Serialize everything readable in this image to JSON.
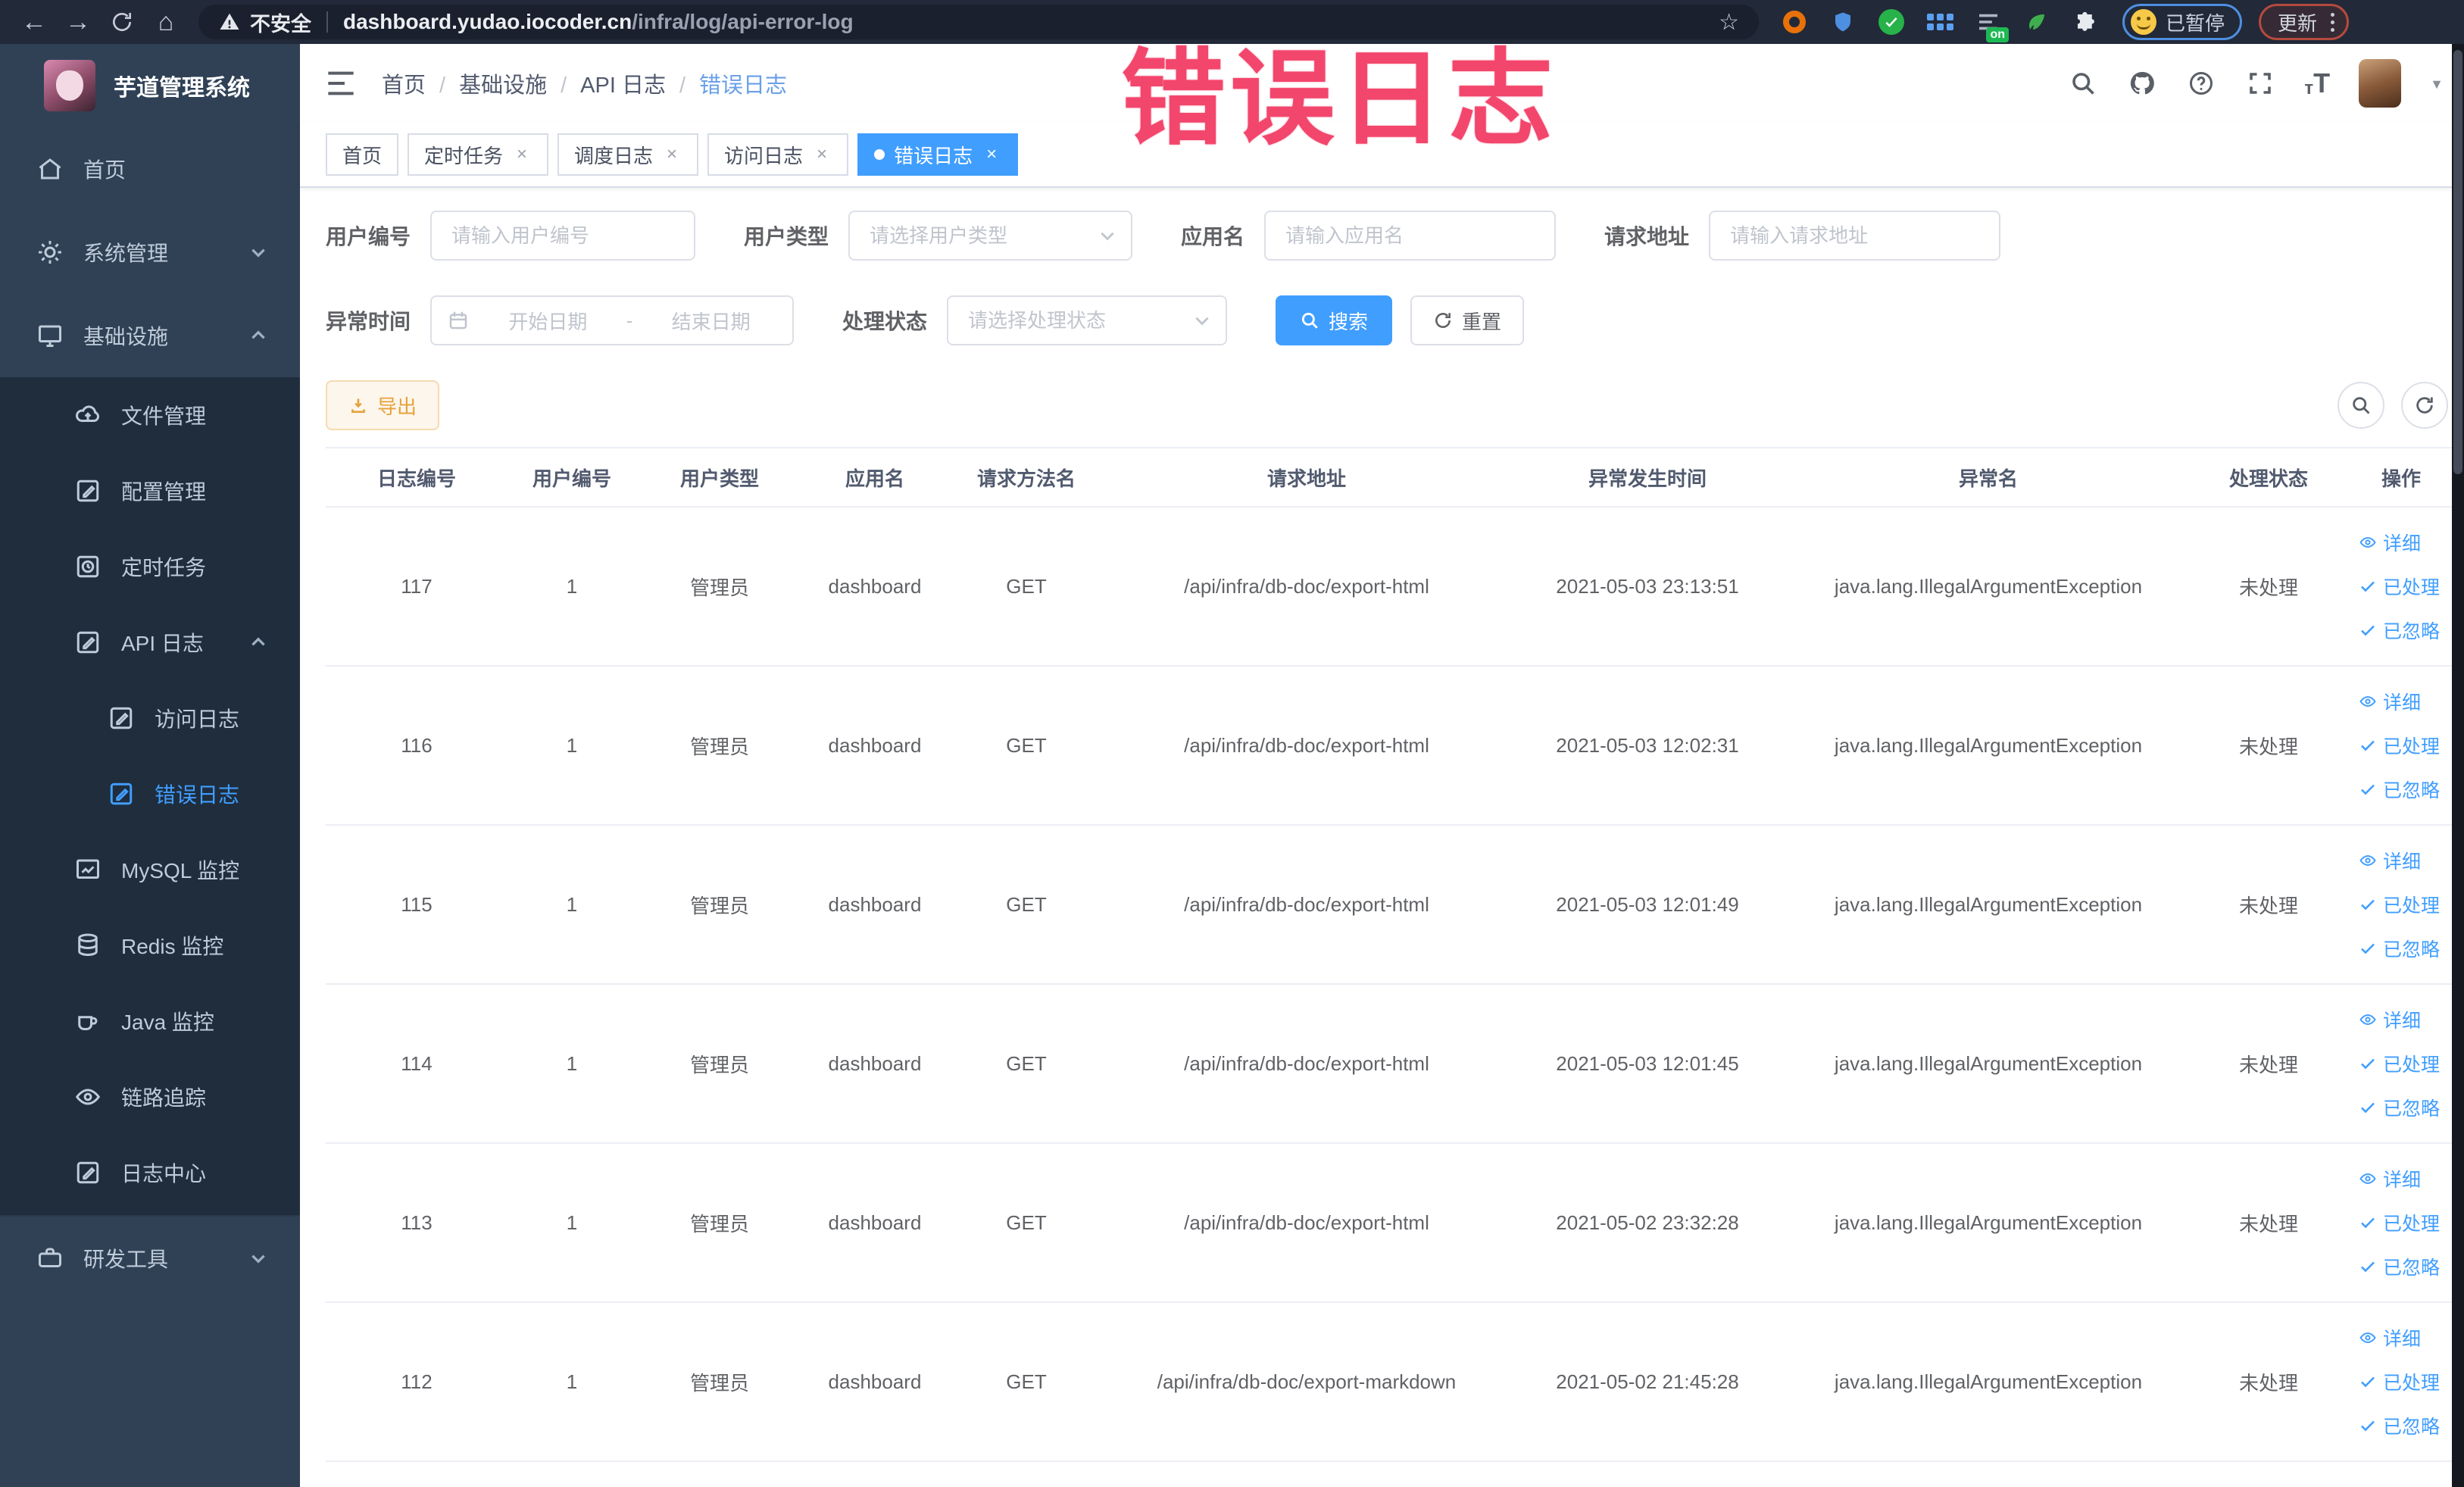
{
  "browser": {
    "security_label": "不安全",
    "url_host": "dashboard.yudao.iocoder.cn",
    "url_path": "/infra/log/api-error-log",
    "paused_badge": "已暂停",
    "update_label": "更新",
    "extension_badge": "on"
  },
  "sidebar": {
    "title": "芋道管理系统",
    "items": [
      {
        "label": "首页",
        "icon": "home-icon"
      },
      {
        "label": "系统管理",
        "icon": "gear-icon"
      },
      {
        "label": "基础设施",
        "icon": "monitor-icon"
      },
      {
        "label": "文件管理",
        "icon": "cloud-upload-icon"
      },
      {
        "label": "配置管理",
        "icon": "edit-icon"
      },
      {
        "label": "定时任务",
        "icon": "timer-icon"
      },
      {
        "label": "API 日志",
        "icon": "log-icon"
      },
      {
        "label": "访问日志",
        "icon": "log-icon"
      },
      {
        "label": "错误日志",
        "icon": "log-icon"
      },
      {
        "label": "MySQL 监控",
        "icon": "chart-icon"
      },
      {
        "label": "Redis 监控",
        "icon": "database-icon"
      },
      {
        "label": "Java 监控",
        "icon": "coffee-icon"
      },
      {
        "label": "链路追踪",
        "icon": "eye-icon"
      },
      {
        "label": "日志中心",
        "icon": "log-icon"
      },
      {
        "label": "研发工具",
        "icon": "toolbox-icon"
      }
    ]
  },
  "header": {
    "breadcrumb": [
      "首页",
      "基础设施",
      "API 日志",
      "错误日志"
    ]
  },
  "tabs": [
    {
      "label": "首页"
    },
    {
      "label": "定时任务"
    },
    {
      "label": "调度日志"
    },
    {
      "label": "访问日志"
    },
    {
      "label": "错误日志"
    }
  ],
  "filters": {
    "user_id": {
      "label": "用户编号",
      "placeholder": "请输入用户编号"
    },
    "user_type": {
      "label": "用户类型",
      "placeholder": "请选择用户类型"
    },
    "app_name": {
      "label": "应用名",
      "placeholder": "请输入应用名"
    },
    "request_url": {
      "label": "请求地址",
      "placeholder": "请输入请求地址"
    },
    "exception_time": {
      "label": "异常时间",
      "start_placeholder": "开始日期",
      "separator": "-",
      "end_placeholder": "结束日期"
    },
    "process_status": {
      "label": "处理状态",
      "placeholder": "请选择处理状态"
    },
    "search_label": "搜索",
    "reset_label": "重置",
    "export_label": "导出"
  },
  "table": {
    "columns": [
      "日志编号",
      "用户编号",
      "用户类型",
      "应用名",
      "请求方法名",
      "请求地址",
      "异常发生时间",
      "异常名",
      "处理状态",
      "操作"
    ],
    "actions": {
      "detail": "详细",
      "processed": "已处理",
      "ignored": "已忽略"
    },
    "rows": [
      {
        "id": "117",
        "user_id": "1",
        "user_type": "管理员",
        "app_name": "dashboard",
        "method": "GET",
        "url": "/api/infra/db-doc/export-html",
        "time": "2021-05-03 23:13:51",
        "exception": "java.lang.IllegalArgumentException",
        "status": "未处理"
      },
      {
        "id": "116",
        "user_id": "1",
        "user_type": "管理员",
        "app_name": "dashboard",
        "method": "GET",
        "url": "/api/infra/db-doc/export-html",
        "time": "2021-05-03 12:02:31",
        "exception": "java.lang.IllegalArgumentException",
        "status": "未处理"
      },
      {
        "id": "115",
        "user_id": "1",
        "user_type": "管理员",
        "app_name": "dashboard",
        "method": "GET",
        "url": "/api/infra/db-doc/export-html",
        "time": "2021-05-03 12:01:49",
        "exception": "java.lang.IllegalArgumentException",
        "status": "未处理"
      },
      {
        "id": "114",
        "user_id": "1",
        "user_type": "管理员",
        "app_name": "dashboard",
        "method": "GET",
        "url": "/api/infra/db-doc/export-html",
        "time": "2021-05-03 12:01:45",
        "exception": "java.lang.IllegalArgumentException",
        "status": "未处理"
      },
      {
        "id": "113",
        "user_id": "1",
        "user_type": "管理员",
        "app_name": "dashboard",
        "method": "GET",
        "url": "/api/infra/db-doc/export-html",
        "time": "2021-05-02 23:32:28",
        "exception": "java.lang.IllegalArgumentException",
        "status": "未处理"
      },
      {
        "id": "112",
        "user_id": "1",
        "user_type": "管理员",
        "app_name": "dashboard",
        "method": "GET",
        "url": "/api/infra/db-doc/export-markdown",
        "time": "2021-05-02 21:45:28",
        "exception": "java.lang.IllegalArgumentException",
        "status": "未处理"
      }
    ]
  },
  "annotation": {
    "text": "错误日志"
  },
  "colors": {
    "accent": "#409eff",
    "warning": "#e6a23c",
    "annotation": "#f3466c",
    "sidebar_bg": "#304156",
    "submenu_bg": "#1f2d3d"
  }
}
